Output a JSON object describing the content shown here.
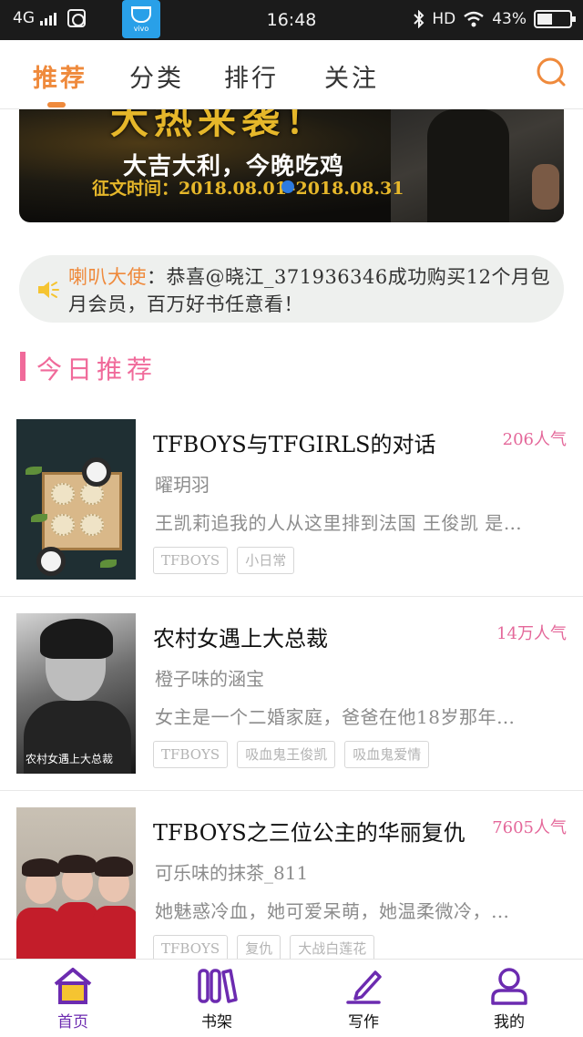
{
  "status_bar": {
    "network": "4G",
    "time": "16:48",
    "hd": "HD",
    "battery": "43%",
    "vivo_label": "vivo"
  },
  "top_nav": {
    "tabs": [
      {
        "label": "推荐",
        "active": true
      },
      {
        "label": "分类",
        "active": false
      },
      {
        "label": "排行",
        "active": false
      },
      {
        "label": "关注",
        "active": false
      }
    ],
    "accent_color": "#ef8a3c"
  },
  "banner": {
    "title": "大热来袭！",
    "slogan": "大吉大利，今晚吃鸡",
    "dates": "征文时间：2018.08.01–2018.08.31"
  },
  "notice": {
    "label": "喇叭大使",
    "text": "：恭喜@晓江_371936346成功购买12个月包月会员，百万好书任意看！"
  },
  "section": {
    "title": "今日推荐",
    "color": "#f06a9a"
  },
  "books": [
    {
      "title": "TFBOYS与TFGIRLS的对话",
      "popularity": "206人气",
      "author": "曜玥羽",
      "description": "王凯莉追我的人从这里排到法国 王俊凯 是…",
      "tags": [
        "TFBOYS",
        "小日常"
      ]
    },
    {
      "title": "农村女遇上大总裁",
      "popularity": "14万人气",
      "author": "橙子味的涵宝",
      "description": "女主是一个二婚家庭，爸爸在他18岁那年…",
      "tags": [
        "TFBOYS",
        "吸血鬼王俊凯",
        "吸血鬼爱情"
      ],
      "cover_text": "农村女遇上大总裁"
    },
    {
      "title": "TFBOYS之三位公主的华丽复仇",
      "popularity": "7605人气",
      "author": "可乐味的抹茶_811",
      "description": "她魅惑冷血，她可爱呆萌，她温柔微冷，…",
      "tags": [
        "TFBOYS",
        "复仇",
        "大战白莲花"
      ]
    }
  ],
  "bottom_nav": {
    "items": [
      {
        "label": "首页",
        "icon": "home-icon",
        "active": true
      },
      {
        "label": "书架",
        "icon": "bookshelf-icon",
        "active": false
      },
      {
        "label": "写作",
        "icon": "pen-icon",
        "active": false
      },
      {
        "label": "我的",
        "icon": "profile-icon",
        "active": false
      }
    ],
    "active_color": "#6c2bb0"
  }
}
